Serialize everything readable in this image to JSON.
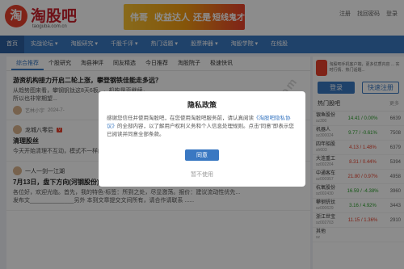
{
  "header": {
    "logo_char": "淘",
    "brand": "淘股吧",
    "brand_sub": "taoguba.com.cn",
    "banner": {
      "t1": "伟哥",
      "t2": "收益达人",
      "t3": "还是",
      "t4": "短线鬼才"
    },
    "top_links": [
      "注册",
      "找回密码",
      "登录"
    ]
  },
  "nav": {
    "items": [
      {
        "label": "首页",
        "active": true
      },
      {
        "label": "实战论坛"
      },
      {
        "label": "淘股研究"
      },
      {
        "label": "千股千评"
      },
      {
        "label": "热门话题"
      },
      {
        "label": "股票神器"
      },
      {
        "label": "淘股学院"
      },
      {
        "label": "在线股"
      }
    ]
  },
  "tabs": [
    "综合推荐",
    "个股研究",
    "淘县神评",
    "同友精选",
    "今日推荐",
    "淘股院子",
    "极速快讯"
  ],
  "posts": [
    {
      "title": "游资机构接力开启二轮上涨，攀登钢铁佳能走多远？",
      "body": "从趋势图来看，攀钢钒钛这8天6板...，机构是否继续，",
      "body2": "所以也非常期望...",
      "author": "艺林小宇",
      "time": "2024-7-"
    },
    {
      "author": "龙城八零后",
      "tag": "V",
      "title": "清理股丝",
      "body": "今天开始清理不互动，模式不一样的股丝，清理到100一下，只留志同道合的股丝。"
    },
    {
      "author": "一人一剑一江湖",
      "title": "7月13日，盘下方向(河钢股份)",
      "body": "各位好，欢迎光临。首先，我的特色-标签：所到之处，尽显激荡。报价：建议流动性优先...",
      "body2": "发布文______________另外 本到文章提交文间所有，请合作请联系 ......"
    }
  ],
  "side": {
    "ad_text": "淘股吧手机客户端，更多优质内容 ... 实时行情、热门话题...",
    "login": "登录",
    "register": "快速注册",
    "hot_title": "热门股吧",
    "hot_more": "更多",
    "stocks": [
      {
        "name": "银鱼股份",
        "code": "sz300",
        "pct": "14.41 / 0.00%",
        "dir": "down",
        "vol": "6639"
      },
      {
        "name": "机器人",
        "code": "sz300024",
        "pct": "9.77 / -0.61%",
        "dir": "down",
        "vol": "7508"
      },
      {
        "name": "四年船股",
        "code": "sh603",
        "pct": "4.13 / 1.48%",
        "dir": "up",
        "vol": "6379"
      },
      {
        "name": "大连重工",
        "code": "sz002204",
        "pct": "8.31 / 0.44%",
        "dir": "up",
        "vol": "5394"
      },
      {
        "name": "中通客车",
        "code": "sz000957",
        "pct": "21.80 / 0.97%",
        "dir": "up",
        "vol": "4958"
      },
      {
        "name": "杭氧股份",
        "code": "sz002430",
        "pct": "16.59 / -4.38%",
        "dir": "down",
        "vol": "3960"
      },
      {
        "name": "攀钢钒钛",
        "code": "sz000629",
        "pct": "3.16 / 4.92%",
        "dir": "down",
        "vol": "3443"
      },
      {
        "name": "浙江世宝",
        "code": "sz002703",
        "pct": "11.15 / 1.36%",
        "dir": "up",
        "vol": "2910"
      },
      {
        "name": "其他",
        "code": "sz",
        "pct": "",
        "dir": "up",
        "vol": ""
      }
    ]
  },
  "modal": {
    "title": "隐私政策",
    "body_pre": "感谢您信任并使用淘股吧，在您使用淘股吧服务前，请认真阅读",
    "link": "《淘股吧隐私协议》",
    "body_post": "的全部内容，以了解用户权利义务和个人信息处理规则。点击“同意”即表示您已阅读并同意全部条款。",
    "agree": "同意",
    "disagree": "暂不使用"
  },
  "watermark": "www.ziyuanm.com"
}
